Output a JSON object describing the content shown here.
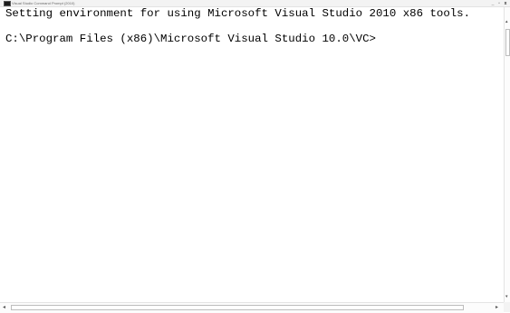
{
  "window": {
    "title": "Visual Studio Command Prompt (2010)",
    "controls": {
      "minimize": "_",
      "restore": "▫",
      "close": "x"
    }
  },
  "console": {
    "lines": [
      "Setting environment for using Microsoft Visual Studio 2010 x86 tools.",
      "C:\\Program Files (x86)\\Microsoft Visual Studio 10.0\\VC>"
    ]
  },
  "scrollbars": {
    "up": "▴",
    "down": "▾",
    "left": "◂",
    "right": "▸"
  },
  "colors": {
    "console_bg": "#ffffff",
    "console_text": "#000000"
  }
}
